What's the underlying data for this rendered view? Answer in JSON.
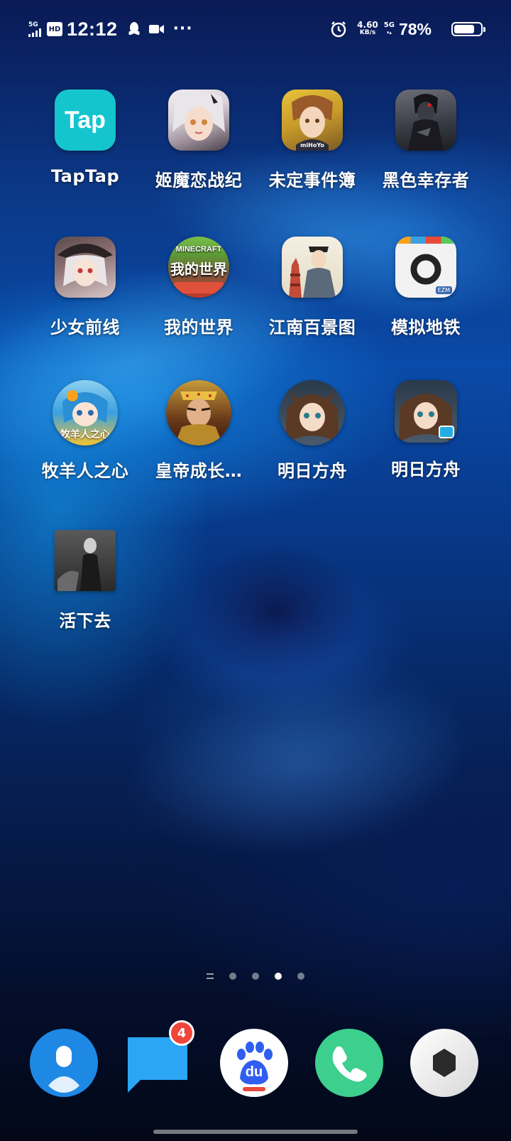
{
  "status_bar": {
    "network_left": "5G",
    "hd": "HD",
    "time": "12:12",
    "more": "···",
    "speed_value": "4.60",
    "speed_unit": "KB/s",
    "network_right": "5G",
    "battery_percent": "78%",
    "battery_level": 0.78
  },
  "apps": [
    {
      "label": "TapTap",
      "icon": "taptap-icon",
      "icon_text": "Tap"
    },
    {
      "label": "姬魔恋战纪",
      "icon": "anime-girl-icon"
    },
    {
      "label": "未定事件簿",
      "icon": "anime-boy-icon",
      "icon_text": "miHoYo"
    },
    {
      "label": "黑色幸存者",
      "icon": "dark-figure-icon"
    },
    {
      "label": "少女前线",
      "icon": "witch-girl-icon"
    },
    {
      "label": "我的世界",
      "icon": "minecraft-icon",
      "icon_text": "MINECRAFT",
      "icon_sub": "我的世界"
    },
    {
      "label": "江南百景图",
      "icon": "scholar-icon"
    },
    {
      "label": "模拟地铁",
      "icon": "metro-icon",
      "icon_text": "EZM"
    },
    {
      "label": "牧羊人之心",
      "icon": "chibi-girl-icon",
      "icon_text": "牧羊人之心"
    },
    {
      "label": "皇帝成长…",
      "icon": "emperor-icon"
    },
    {
      "label": "明日方舟",
      "icon": "arknights-icon"
    },
    {
      "label": "明日方舟",
      "icon": "arknights-bili-icon"
    },
    {
      "label": "活下去",
      "icon": "survivor-icon"
    }
  ],
  "pager": {
    "pages": 4,
    "active_index": 2
  },
  "dock": [
    {
      "name": "contacts",
      "icon": "contacts-icon"
    },
    {
      "name": "messages",
      "icon": "message-icon",
      "badge": "4"
    },
    {
      "name": "baidu",
      "icon": "baidu-paw-icon",
      "icon_text": "du"
    },
    {
      "name": "phone",
      "icon": "phone-icon"
    },
    {
      "name": "settings",
      "icon": "hexagon-icon"
    }
  ],
  "colors": {
    "taptap": "#15c5ce",
    "dock_contacts": "#1e88e5",
    "dock_messages": "#2aa6f5",
    "dock_phone": "#3ccf8e",
    "badge": "#f0453a"
  }
}
